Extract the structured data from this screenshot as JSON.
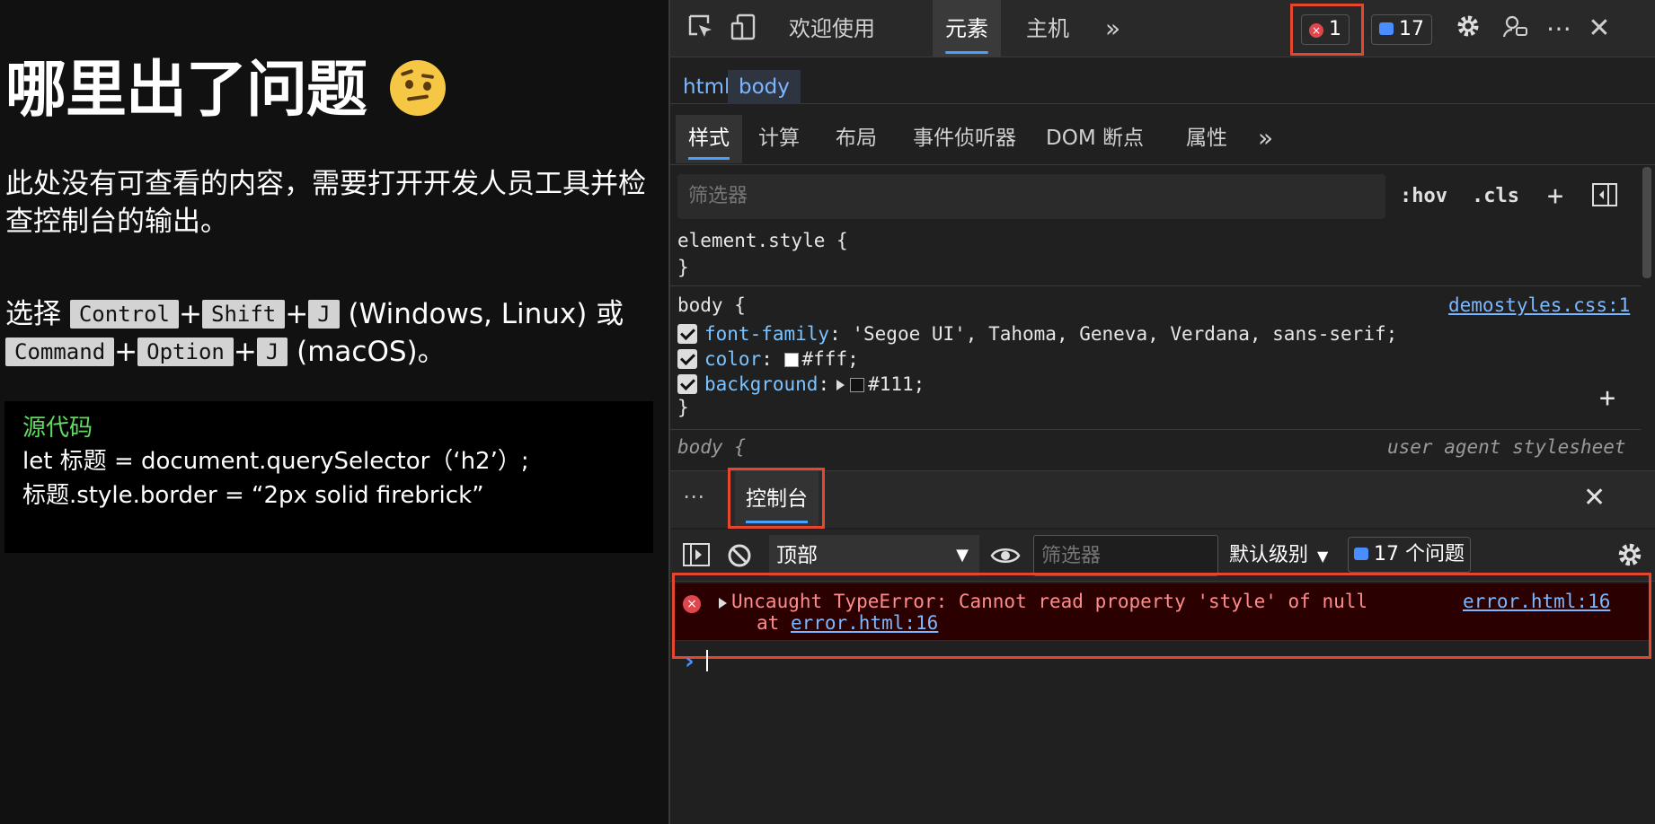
{
  "page": {
    "heading": "哪里出了问题",
    "emoji_icon": "face-with-raised-eyebrow-icon",
    "intro": "此处没有可查看的内容，需要打开开发人员工具并检查控制台的输出。",
    "shortcut": {
      "prefix": "选择",
      "win_keys": [
        "Control",
        "Shift",
        "J"
      ],
      "win_os": "(Windows, Linux) 或",
      "mac_keys": [
        "Command",
        "Option",
        "J"
      ],
      "mac_os": "(macOS)。",
      "plus": "+"
    },
    "source": {
      "title": "源代码",
      "line1": "let 标题 = document.querySelector（‘h2’）;",
      "line2": "标题.style.border = “2px solid firebrick”"
    }
  },
  "devtools": {
    "tabs": {
      "welcome": "欢迎使用",
      "elements": "元素",
      "sources": "主机",
      "more": "»"
    },
    "badges": {
      "errors": "1",
      "issues": "17"
    },
    "breadcrumb": [
      "html",
      "body"
    ],
    "subtabs": [
      "样式",
      "计算",
      "布局",
      "事件侦听器",
      "DOM 断点",
      "属性",
      "»"
    ],
    "styles": {
      "filter_placeholder": "筛选器",
      "hov": ":hov",
      "cls": ".cls",
      "element_style_open": "element.style {",
      "close_brace": "}",
      "body_rule": {
        "selector": "body {",
        "source": "demostyles.css:1",
        "props": [
          {
            "name": "font-family",
            "value": "'Segoe UI', Tahoma, Geneva, Verdana, sans-serif;"
          },
          {
            "name": "color",
            "value": "#fff;",
            "swatch": "#ffffff"
          },
          {
            "name": "background",
            "value": "#111;",
            "swatch": "#111111"
          }
        ]
      },
      "ua_rule": {
        "selector": "body {",
        "source": "user agent stylesheet"
      }
    },
    "drawer": {
      "console_tab": "控制台"
    },
    "console": {
      "context": "顶部",
      "filter_placeholder": "筛选器",
      "levels": "默认级别",
      "issues": "17 个问题",
      "error": {
        "message": "Uncaught TypeError: Cannot read property 'style' of null",
        "at": "at",
        "at_link": "error.html:16",
        "source": "error.html:16"
      },
      "prompt": "›"
    }
  },
  "colors": {
    "highlight_box": "#e5462d",
    "error_bg": "#2a0000",
    "accent": "#4a9fff"
  }
}
